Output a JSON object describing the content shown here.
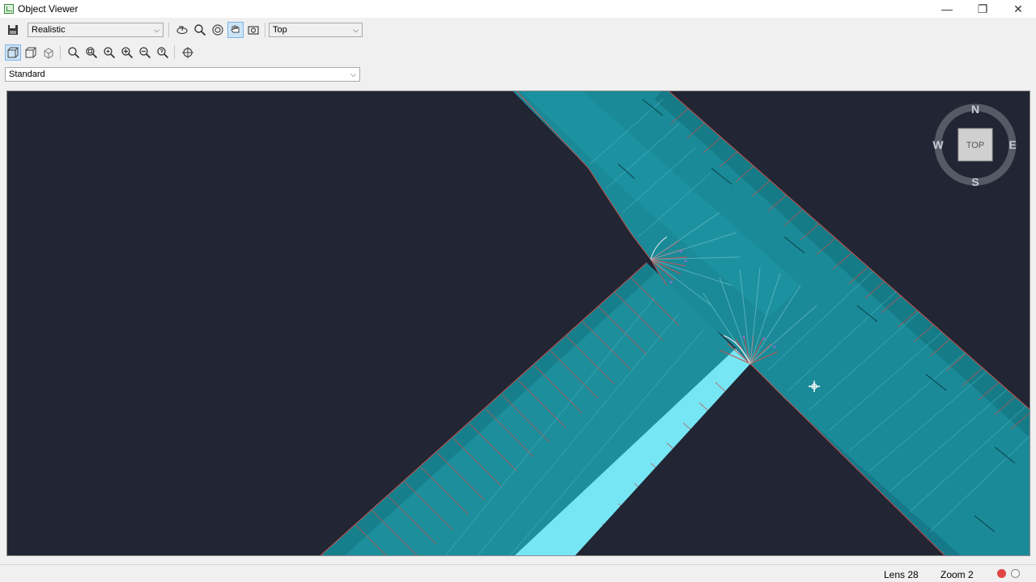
{
  "window": {
    "title": "Object Viewer",
    "controls": {
      "minimize": "—",
      "restore": "❐",
      "close": "✕"
    }
  },
  "toolbar": {
    "visual_style": "Realistic",
    "view_direction": "Top",
    "style_set": "Standard"
  },
  "viewcube": {
    "north": "N",
    "south": "S",
    "east": "E",
    "west": "W",
    "face": "TOP"
  },
  "statusbar": {
    "lens": "Lens 28",
    "zoom": "Zoom 2"
  },
  "colors": {
    "viewport_bg": "#222533",
    "road": "#1a8a98",
    "road_light": "#76e6f5",
    "hatch": "#c4534e"
  }
}
